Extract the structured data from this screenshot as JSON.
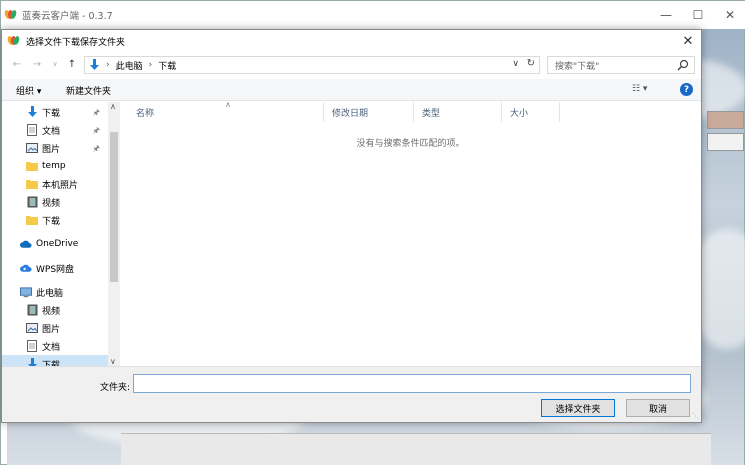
{
  "app": {
    "title": "蓝奏云客户端 - 0.3.7"
  },
  "dialog": {
    "title": "选择文件下载保存文件夹",
    "address": [
      "此电脑",
      "下载"
    ],
    "search_placeholder": "搜索\"下载\"",
    "toolbar": {
      "organize": "组织 ▾",
      "new_folder": "新建文件夹"
    },
    "nav": [
      {
        "label": "下载",
        "icon": "download-icon",
        "pinned": true
      },
      {
        "label": "文档",
        "icon": "document-icon",
        "pinned": true
      },
      {
        "label": "图片",
        "icon": "picture-icon",
        "pinned": true
      },
      {
        "label": "temp",
        "icon": "folder-icon"
      },
      {
        "label": "本机照片",
        "icon": "folder-icon"
      },
      {
        "label": "视频",
        "icon": "video-icon"
      },
      {
        "label": "下载",
        "icon": "folder-icon"
      },
      {
        "label": "OneDrive",
        "icon": "cloud-icon"
      },
      {
        "label": "WPS网盘",
        "icon": "wps-cloud-icon"
      },
      {
        "label": "此电脑",
        "icon": "computer-icon"
      },
      {
        "label": "视频",
        "icon": "video-icon"
      },
      {
        "label": "图片",
        "icon": "picture-icon"
      },
      {
        "label": "文档",
        "icon": "document-icon"
      },
      {
        "label": "下载",
        "icon": "download-icon",
        "selected": true
      }
    ],
    "columns": [
      "名称",
      "修改日期",
      "类型",
      "大小"
    ],
    "empty_message": "没有与搜索条件匹配的项。",
    "folder_label": "文件夹:",
    "folder_value": "",
    "select_button": "选择文件夹",
    "cancel_button": "取消"
  },
  "colors": {
    "accent": "#0078d7",
    "selection": "#cce4f7",
    "help": "#1667c7"
  }
}
